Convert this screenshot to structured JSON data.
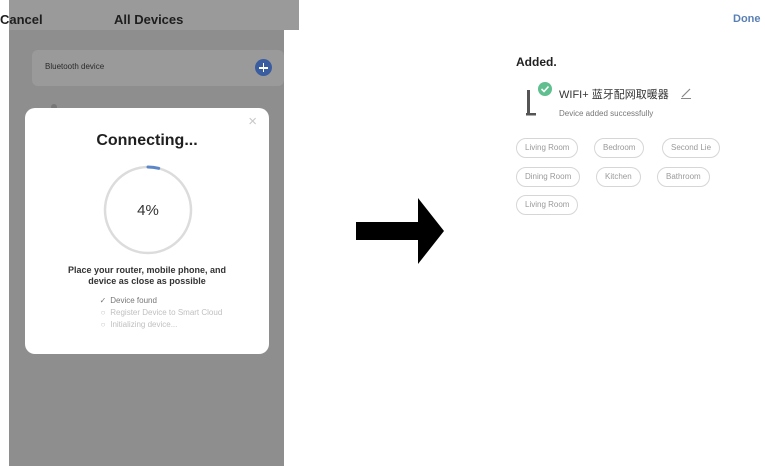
{
  "left_screen": {
    "cancel_label": "Cancel",
    "title": "All Devices",
    "bluetooth_row_label": "Bluetooth device"
  },
  "modal": {
    "title": "Connecting...",
    "progress_percent": 4,
    "progress_text": "4%",
    "instruction_line1": "Place your router, mobile phone, and",
    "instruction_line2": "device as close as possible",
    "steps": [
      {
        "label": "Device found",
        "mark": "✓",
        "done": true
      },
      {
        "label": "Register Device to Smart Cloud",
        "mark": "○",
        "done": false
      },
      {
        "label": "Initializing device...",
        "mark": "○",
        "done": false
      }
    ]
  },
  "right_screen": {
    "done_label": "Done",
    "heading": "Added.",
    "device_name": "WIFI+ 蓝牙配网取暖器",
    "device_status": "Device added successfully",
    "rooms": [
      "Living Room",
      "Bedroom",
      "Second Lie",
      "Dining Room",
      "Kitchen",
      "Bathroom",
      "Living Room"
    ]
  },
  "colors": {
    "progress_arc": "#5b86c8",
    "success_check": "#5fbf8f",
    "done_link": "#5a7fb5"
  },
  "icons": {
    "close": "close-icon",
    "add": "plus-circle-icon",
    "edit": "pencil-icon",
    "arrow": "arrow-right-icon",
    "device": "heater-device-icon",
    "success": "check-circle-icon"
  }
}
